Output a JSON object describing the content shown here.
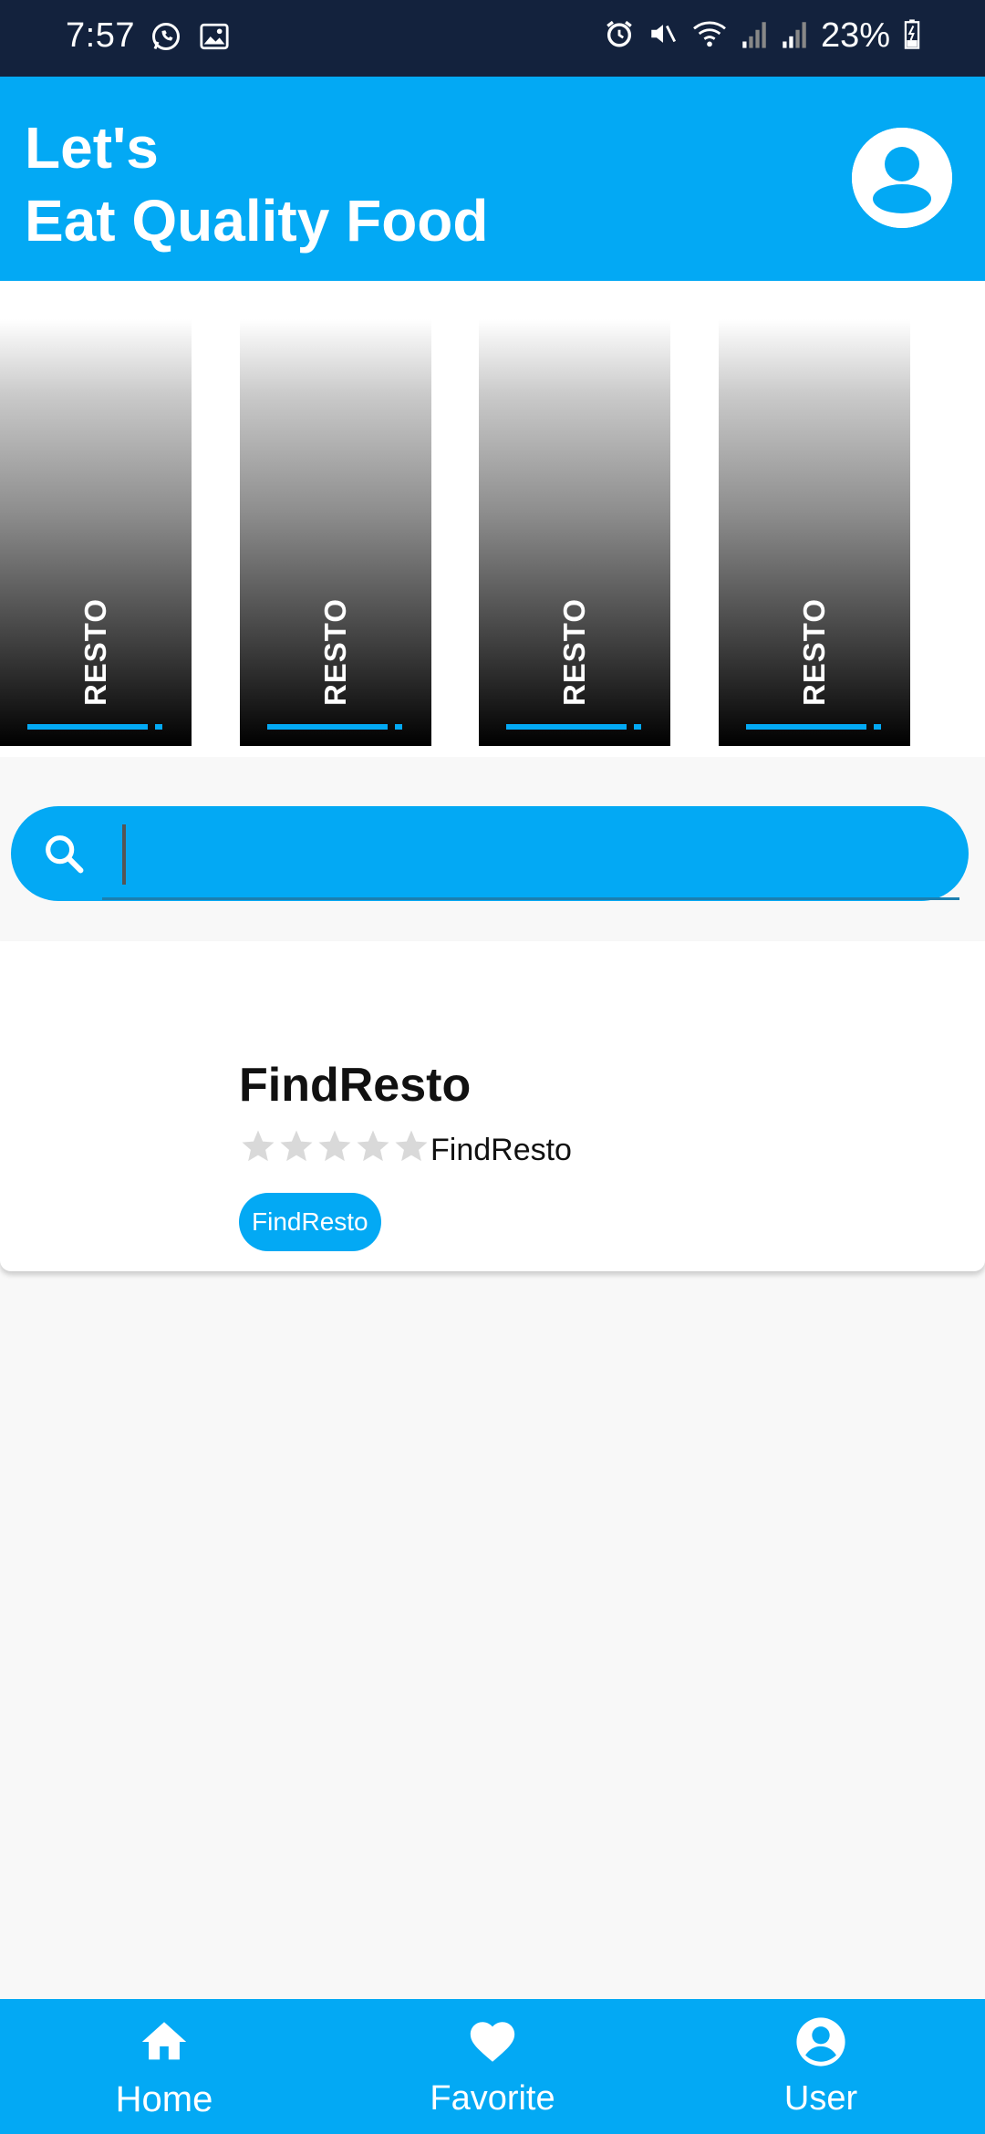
{
  "status_bar": {
    "time": "7:57",
    "battery": "23%",
    "icons": [
      "whatsapp-icon",
      "gallery-icon",
      "alarm-icon",
      "mute-icon",
      "wifi-icon",
      "signal-icon",
      "signal-icon",
      "battery-charging-icon"
    ]
  },
  "header": {
    "title_line1": "Let's",
    "title_line2": "Eat Quality Food",
    "avatar_icon": "account-circle-icon"
  },
  "carousel": {
    "cards": [
      {
        "label": "RESTO"
      },
      {
        "label": "RESTO"
      },
      {
        "label": "RESTO"
      },
      {
        "label": "RESTO"
      }
    ]
  },
  "search": {
    "icon": "search-icon",
    "value": "",
    "placeholder": ""
  },
  "result": {
    "title": "FindResto",
    "rating_stars_filled": 0,
    "rating_stars_total": 5,
    "subtitle": "FindResto",
    "chip": "FindResto"
  },
  "bottom_nav": {
    "items": [
      {
        "label": "Home",
        "icon": "home-icon",
        "active": true
      },
      {
        "label": "Favorite",
        "icon": "heart-icon",
        "active": false
      },
      {
        "label": "User",
        "icon": "account-circle-icon",
        "active": false
      }
    ]
  },
  "colors": {
    "primary": "#03a9f4",
    "status_bar": "#13223d",
    "background": "#f8f8f8",
    "star_empty": "#d9d9d9"
  }
}
